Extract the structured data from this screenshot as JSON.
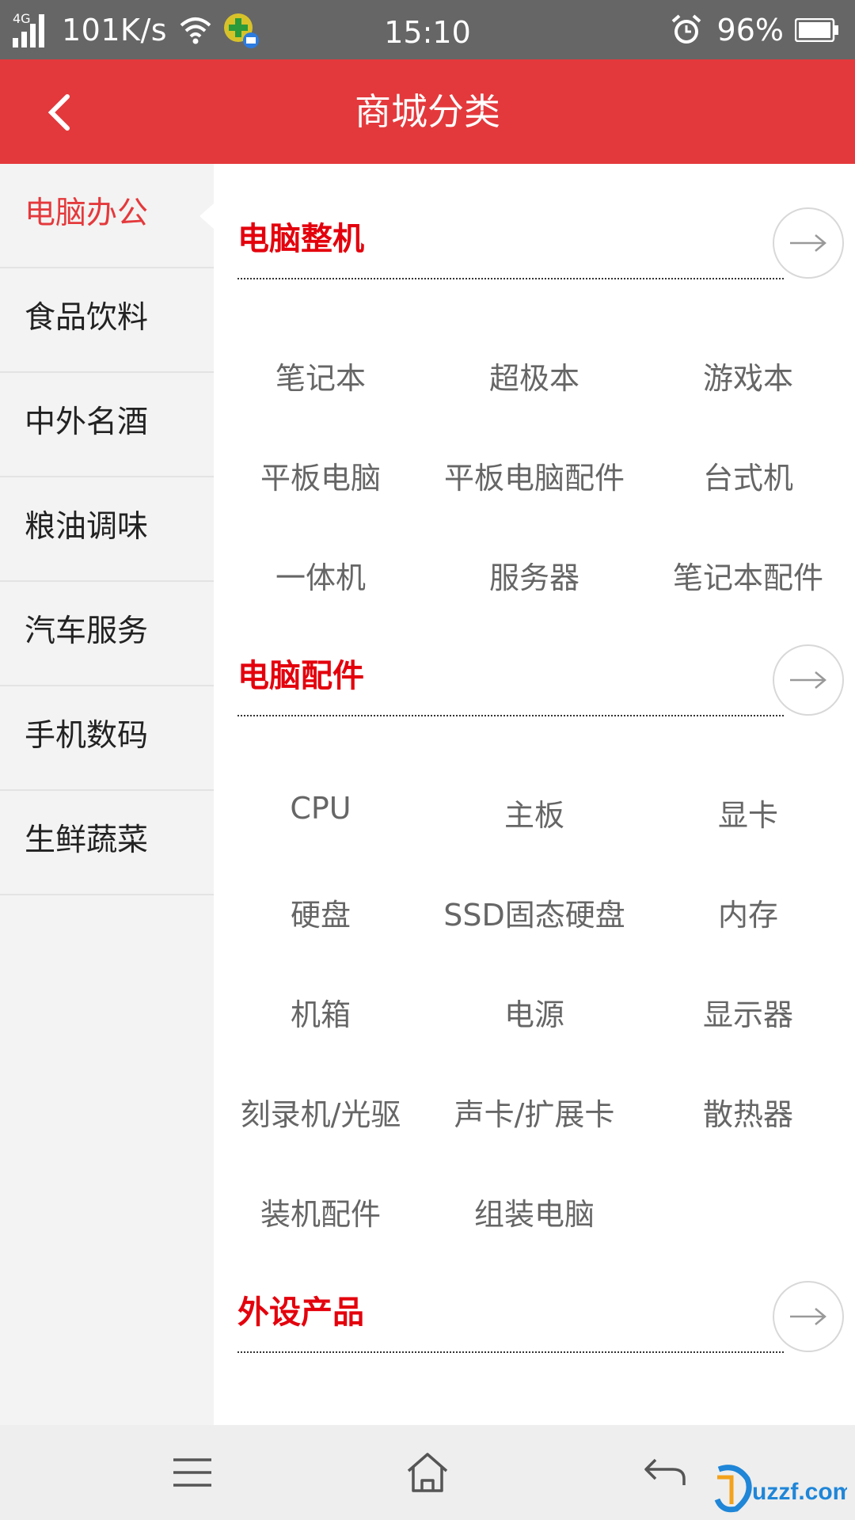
{
  "status_bar": {
    "network_type": "4G",
    "speed": "101K/s",
    "time": "15:10",
    "battery": "96%",
    "icons": [
      "signal-icon",
      "wifi-icon",
      "app-notification-icon",
      "alarm-icon",
      "battery-icon"
    ]
  },
  "header": {
    "title": "商城分类",
    "back_icon": "chevron-left-icon",
    "background": "#e4393c"
  },
  "sidebar": {
    "active_index": 0,
    "items": [
      {
        "label": "电脑办公"
      },
      {
        "label": "食品饮料"
      },
      {
        "label": "中外名酒"
      },
      {
        "label": "粮油调味"
      },
      {
        "label": "汽车服务"
      },
      {
        "label": "手机数码"
      },
      {
        "label": "生鲜蔬菜"
      }
    ]
  },
  "sections": [
    {
      "title": "电脑整机",
      "items": [
        "笔记本",
        "超极本",
        "游戏本",
        "平板电脑",
        "平板电脑配件",
        "台式机",
        "一体机",
        "服务器",
        "笔记本配件"
      ]
    },
    {
      "title": "电脑配件",
      "items": [
        "CPU",
        "主板",
        "显卡",
        "硬盘",
        "SSD固态硬盘",
        "内存",
        "机箱",
        "电源",
        "显示器",
        "刻录机/光驱",
        "声卡/扩展卡",
        "散热器",
        "装机配件",
        "组装电脑"
      ]
    },
    {
      "title": "外设产品",
      "items": []
    }
  ],
  "colors": {
    "accent": "#e4393c",
    "section_title": "#e4000c",
    "item_text": "#666666"
  },
  "nav_bar": {
    "icons": [
      "menu-icon",
      "home-icon",
      "back-arrow-icon"
    ],
    "watermark_text": "uzzf.com"
  }
}
